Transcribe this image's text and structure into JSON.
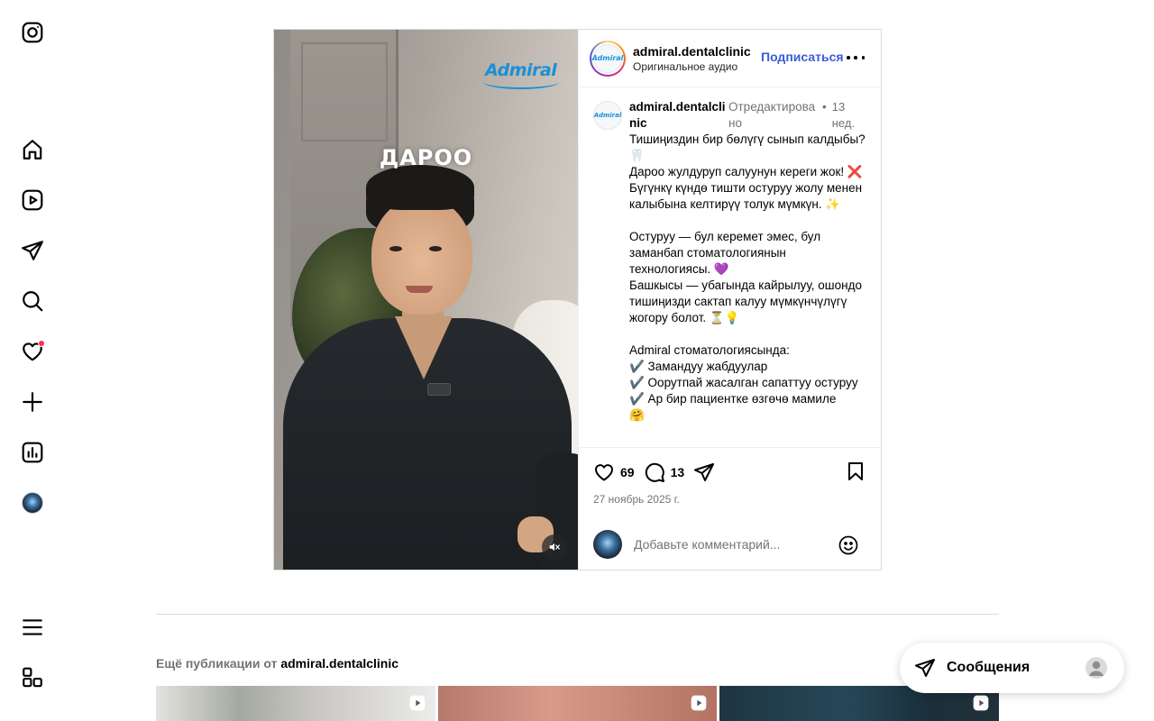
{
  "sidebar": {
    "items": [
      {
        "name": "instagram-logo-icon"
      },
      {
        "name": "home-icon"
      },
      {
        "name": "reels-icon"
      },
      {
        "name": "direct-messages-icon"
      },
      {
        "name": "search-icon"
      },
      {
        "name": "notifications-heart-icon"
      },
      {
        "name": "create-plus-icon"
      },
      {
        "name": "dashboard-icon"
      },
      {
        "name": "profile-avatar"
      },
      {
        "name": "menu-hamburger-icon"
      },
      {
        "name": "more-apps-icon"
      }
    ],
    "notification_color": "#ff3040"
  },
  "post": {
    "media": {
      "overlay_title": "ДАРОО",
      "brand_logo": "Admiral"
    },
    "header": {
      "username": "admiral.dentalclinic",
      "audio": "Оригинальное аудио",
      "follow_label": "Подписаться"
    },
    "caption": {
      "username": "admiral.dentalclinic",
      "edited": "Отредактировано",
      "dot": "•",
      "time": "13 нед.",
      "text": "Тишиңиздин бир бөлүгү сынып калдыбы? 🦷\nДароо жулдуруп салуунун кереги жок! ❌\nБүгүнкү күндө тишти остуруу жолу менен калыбына келтирүү толук мүмкүн. ✨\n\nОстуруу — бул керемет эмес, бул заманбап стоматологиянын технологиясы. 💜\nБашкысы — убагында кайрылуу, ошондо тишиңизди сактап калуу мүмкүнчүлүгү жогору болот. ⏳💡\n\nAdmiral стоматологиясында:\n✔️ Замандуу жабдуулар\n✔️ Оорутпай жасалган сапаттуу остуруу\n✔️ Ар бир пациентке өзгөчө мамиле\n🤗"
    },
    "actions": {
      "likes": "69",
      "comments": "13",
      "date": "27 ноябрь 2025 г."
    },
    "comment_placeholder": "Добавьте комментарий..."
  },
  "more_publications": {
    "prefix": "Ещё публикации от",
    "account": "admiral.dentalclinic"
  },
  "messages": {
    "label": "Сообщения"
  },
  "colors": {
    "accent_link": "#3b5dd9",
    "secondary_text": "#737373",
    "border": "#dbdbdb"
  }
}
